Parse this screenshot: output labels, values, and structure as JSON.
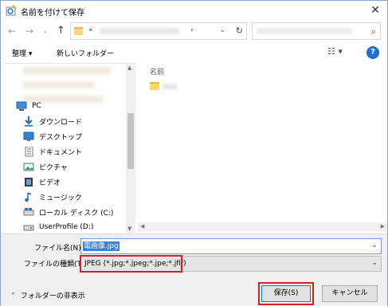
{
  "window": {
    "title": "名前を付けて保存",
    "close_glyph": "✕"
  },
  "nav": {
    "back_glyph": "←",
    "forward_glyph": "→",
    "recent_glyph": "⌄",
    "up_glyph": "↑",
    "address_chevrons": "«",
    "address_separator": "›",
    "address_dropdown_glyph": "⌄",
    "refresh_glyph": "↻",
    "search_glyph": "⌕"
  },
  "toolbar": {
    "organize_label": "整理 ▾",
    "new_folder_label": "新しいフォルダー",
    "view_glyph": "☷ ▾",
    "help_glyph": "?"
  },
  "sidebar": {
    "items": [
      {
        "label": "PC",
        "icon": "pc-icon"
      },
      {
        "label": "ダウンロード",
        "icon": "download-icon"
      },
      {
        "label": "デスクトップ",
        "icon": "desktop-icon"
      },
      {
        "label": "ドキュメント",
        "icon": "documents-icon"
      },
      {
        "label": "ピクチャ",
        "icon": "pictures-icon"
      },
      {
        "label": "ビデオ",
        "icon": "videos-icon"
      },
      {
        "label": "ミュージック",
        "icon": "music-icon"
      },
      {
        "label": "ローカル ディスク (C:)",
        "icon": "drive-icon"
      },
      {
        "label": "UserProfile (D:)",
        "icon": "drive-icon"
      }
    ]
  },
  "filepane": {
    "column_name": "名前"
  },
  "form": {
    "filename_label": "ファイル名(N):",
    "filename_value": "電画像.jpg",
    "filetype_label": "ファイルの種類(T):",
    "filetype_value": "JPEG (*.jpg;*.jpeg;*.jpe;*.jfif)",
    "dropdown_glyph": "⌄"
  },
  "footer": {
    "hide_folders_label": "フォルダーの非表示",
    "hide_folders_glyph": "⌃",
    "save_label": "保存(S)",
    "cancel_label": "キャンセル"
  },
  "colors": {
    "highlight_red": "#d21f2a",
    "accent_blue": "#0078d7"
  }
}
